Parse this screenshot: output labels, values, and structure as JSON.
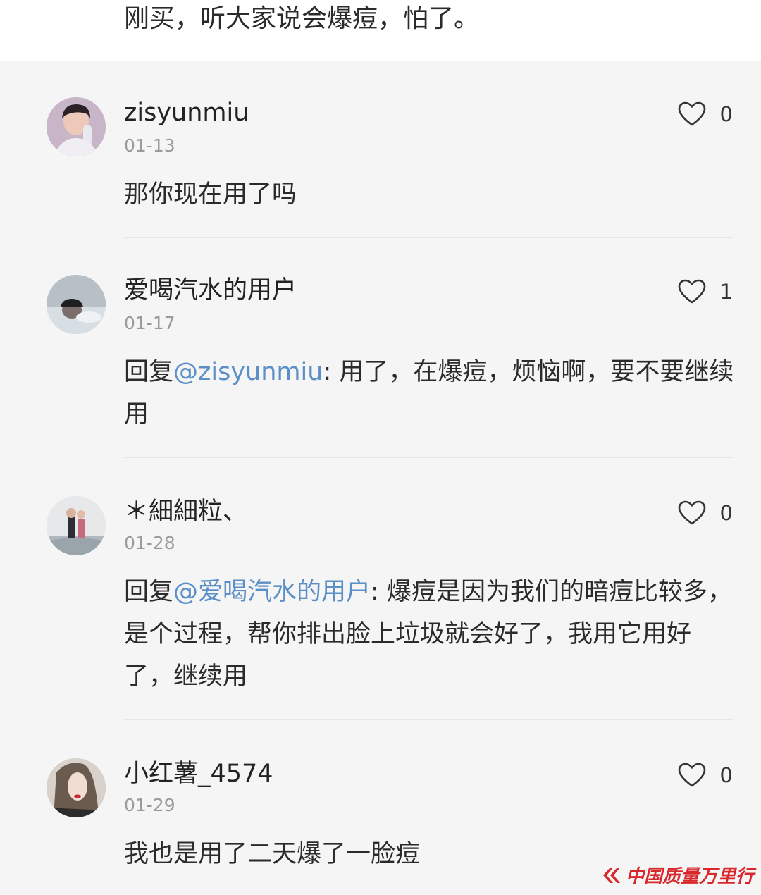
{
  "post": {
    "text": "刚买，听大家说会爆痘，怕了。"
  },
  "comments": [
    {
      "username": "zisyunmiu",
      "date": "01-13",
      "likes": "0",
      "text": "那你现在用了吗"
    },
    {
      "username": "爱喝汽水的用户",
      "date": "01-17",
      "likes": "1",
      "reply_prefix": "回复",
      "mention": "@zisyunmiu",
      "text_rest": ": 用了，在爆痘，烦恼啊，要不要继续用"
    },
    {
      "username": "＊細細粒、",
      "date": "01-28",
      "likes": "0",
      "reply_prefix": "回复",
      "mention": "@爱喝汽水的用户",
      "text_rest": ": 爆痘是因为我们的暗痘比较多，是个过程，帮你排出脸上垃圾就会好了，我用它用好了，继续用"
    },
    {
      "username": "小红薯_4574",
      "date": "01-29",
      "likes": "0",
      "text": "我也是用了二天爆了一脸痘"
    }
  ],
  "watermark": {
    "text": "中国质量万里行"
  },
  "colors": {
    "mention": "#5b8fc7",
    "watermark": "#d8282c",
    "date": "#9b9b9b"
  },
  "icons": {
    "like": "heart-outline-icon"
  }
}
